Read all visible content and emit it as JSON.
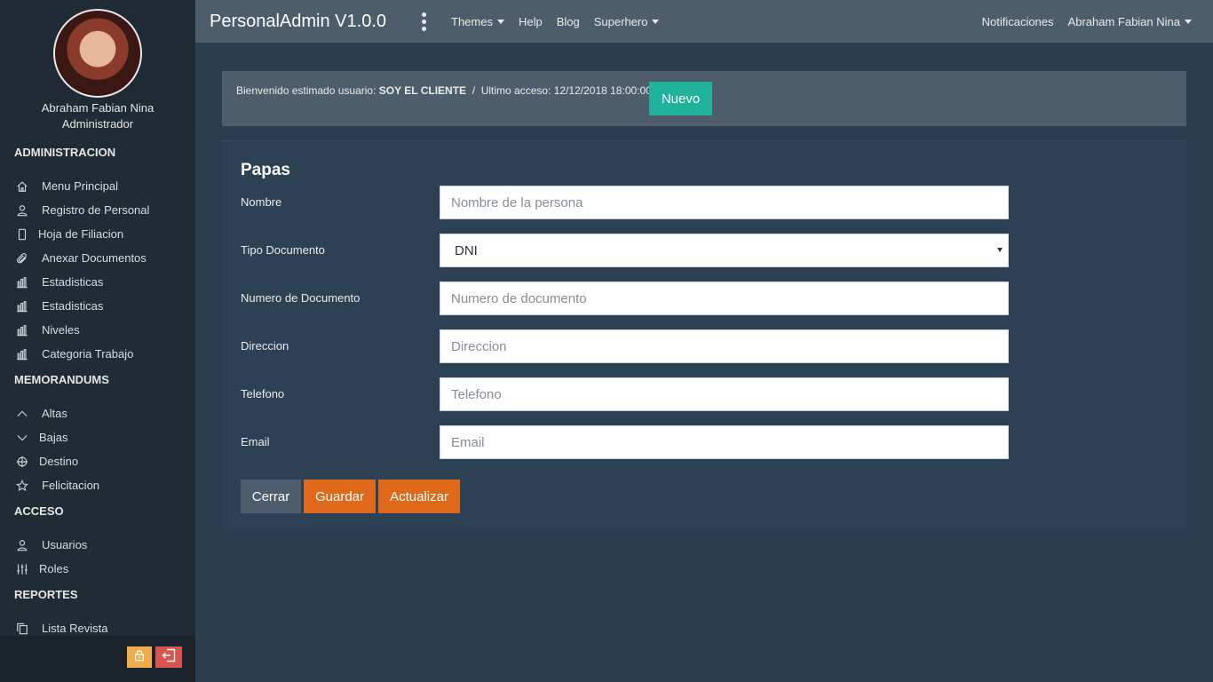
{
  "profile": {
    "name": "Abraham Fabian Nina",
    "role": "Administrador"
  },
  "sidebar": {
    "sections": [
      {
        "title": "ADMINISTRACION",
        "items": [
          {
            "label": "Menu Principal",
            "icon": "home-icon"
          },
          {
            "label": "Registro de Personal",
            "icon": "user-icon"
          },
          {
            "label": "Hoja de Filiacion",
            "icon": "document-icon"
          },
          {
            "label": "Anexar Documentos",
            "icon": "paperclip-icon"
          },
          {
            "label": "Estadisticas",
            "icon": "bar-chart-icon"
          },
          {
            "label": "Estadisticas",
            "icon": "bar-chart-icon"
          },
          {
            "label": "Niveles",
            "icon": "bar-chart-icon"
          },
          {
            "label": "Categoria Trabajo",
            "icon": "bar-chart-icon"
          }
        ]
      },
      {
        "title": "MEMORANDUMS",
        "items": [
          {
            "label": "Altas",
            "icon": "chevron-up-icon"
          },
          {
            "label": "Bajas",
            "icon": "chevron-down-icon"
          },
          {
            "label": "Destino",
            "icon": "crosshair-icon"
          },
          {
            "label": "Felicitacion",
            "icon": "star-icon"
          }
        ]
      },
      {
        "title": "ACCESO",
        "items": [
          {
            "label": "Usuarios",
            "icon": "user-icon"
          },
          {
            "label": "Roles",
            "icon": "sliders-icon"
          }
        ]
      },
      {
        "title": "REPORTES",
        "items": [
          {
            "label": "Lista Revista",
            "icon": "copy-icon"
          }
        ]
      }
    ]
  },
  "navbar": {
    "brand": "PersonalAdmin V1.0.0",
    "links": [
      {
        "label": "Themes",
        "dropdown": true
      },
      {
        "label": "Help",
        "dropdown": false
      },
      {
        "label": "Blog",
        "dropdown": false
      },
      {
        "label": "Superhero",
        "dropdown": true
      }
    ],
    "notifications": "Notificaciones",
    "user": "Abraham Fabian Nina"
  },
  "welcome": {
    "prefix": "Bienvenido estimado usuario:",
    "user": "SOY EL CLIENTE",
    "separator": "/",
    "last_access": "Ultimo acceso: 12/12/2018 18:00:00",
    "new_button": "Nuevo"
  },
  "form": {
    "title": "Papas",
    "fields": [
      {
        "label": "Nombre",
        "placeholder": "Nombre de la persona",
        "type": "text"
      },
      {
        "label": "Tipo Documento",
        "value": "DNI",
        "type": "select"
      },
      {
        "label": "Numero de Documento",
        "placeholder": "Numero de documento",
        "type": "text"
      },
      {
        "label": "Direccion",
        "placeholder": "Direccion",
        "type": "text"
      },
      {
        "label": "Telefono",
        "placeholder": "Telefono",
        "type": "text"
      },
      {
        "label": "Email",
        "placeholder": "Email",
        "type": "text"
      }
    ],
    "buttons": {
      "close": "Cerrar",
      "save": "Guardar",
      "update": "Actualizar"
    }
  },
  "colors": {
    "primary_bg": "#2b3e50",
    "navbar_bg": "#4e5d6c",
    "accent_orange": "#df691a",
    "accent_teal": "#20b29a",
    "warning": "#f0ad4e",
    "danger": "#d9534f"
  }
}
